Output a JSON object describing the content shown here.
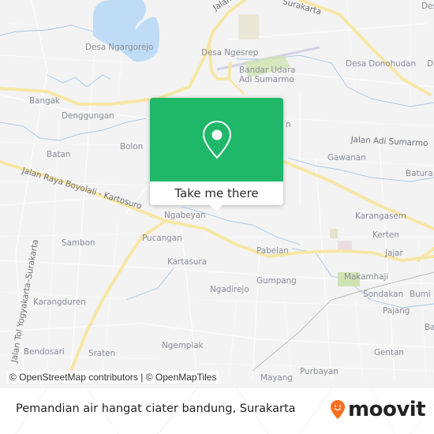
{
  "map": {
    "labels": {
      "desa_ngargorejo": "Desa Ngargorejo",
      "desa_ngesrep": "Desa Ngesrep",
      "bandar_udara_1": "Bandar Udara",
      "bandar_udara_2": "Adi Sumarmo",
      "desa_donohudan": "Desa Donohudan",
      "bangak": "Bangak",
      "denggungan": "Denggungan",
      "batan": "Batan",
      "bolon": "Bolon",
      "jalan_adi_sumarmo": "Jalan Adi Sumarmo",
      "gawanan": "Gawanan",
      "batura": "Batura",
      "jalan_raya_boyolali": "Jalan Raya Boyolali - Kartosuro",
      "ngabeyan": "Ngabeyan",
      "karangasem": "Karangasem",
      "kerten": "Kerten",
      "jajar": "Jajar",
      "sambon": "Sambon",
      "pucangan": "Pucangan",
      "kartasura": "Kartasura",
      "pabelan": "Pabelan",
      "gumpang": "Gumpang",
      "makamhaji": "Makamhaji",
      "ngadirejo": "Ngadirejo",
      "sondakan": "Sondakan",
      "bumi": "Bumi",
      "pajang": "Pajang",
      "karangduren": "Karangduren",
      "jalan_tol_yogya": "Jalan Tol Yogyakarta–Surakarta",
      "ngemplak": "Ngemplak",
      "bendosari": "Bendosari",
      "sraten": "Sraten",
      "gentan": "Gentan",
      "purbayan": "Purbayan",
      "mayang": "Mayang",
      "jalan_tol_top": "Jalan Tol",
      "surakarta_top": "Surakarta",
      "partial_n": "n",
      "partial_desa_right": "Des",
      "partial_d": "D",
      "partial_ba": "Ba"
    },
    "attribution": "© OpenStreetMap contributors | © OpenMapTiles",
    "colors": {
      "land": "#f3f3f4",
      "water": "#bfdcf7",
      "major_road": "#f7e7a4",
      "park": "#cfe3b0"
    }
  },
  "popup": {
    "icon": "map-pin-icon",
    "button_label": "Take me there",
    "color": "#1fb868"
  },
  "footer": {
    "title": "Pemandian air hangat ciater bandung, Surakarta",
    "brand": "moovit",
    "brand_color": "#ff6d1f"
  }
}
